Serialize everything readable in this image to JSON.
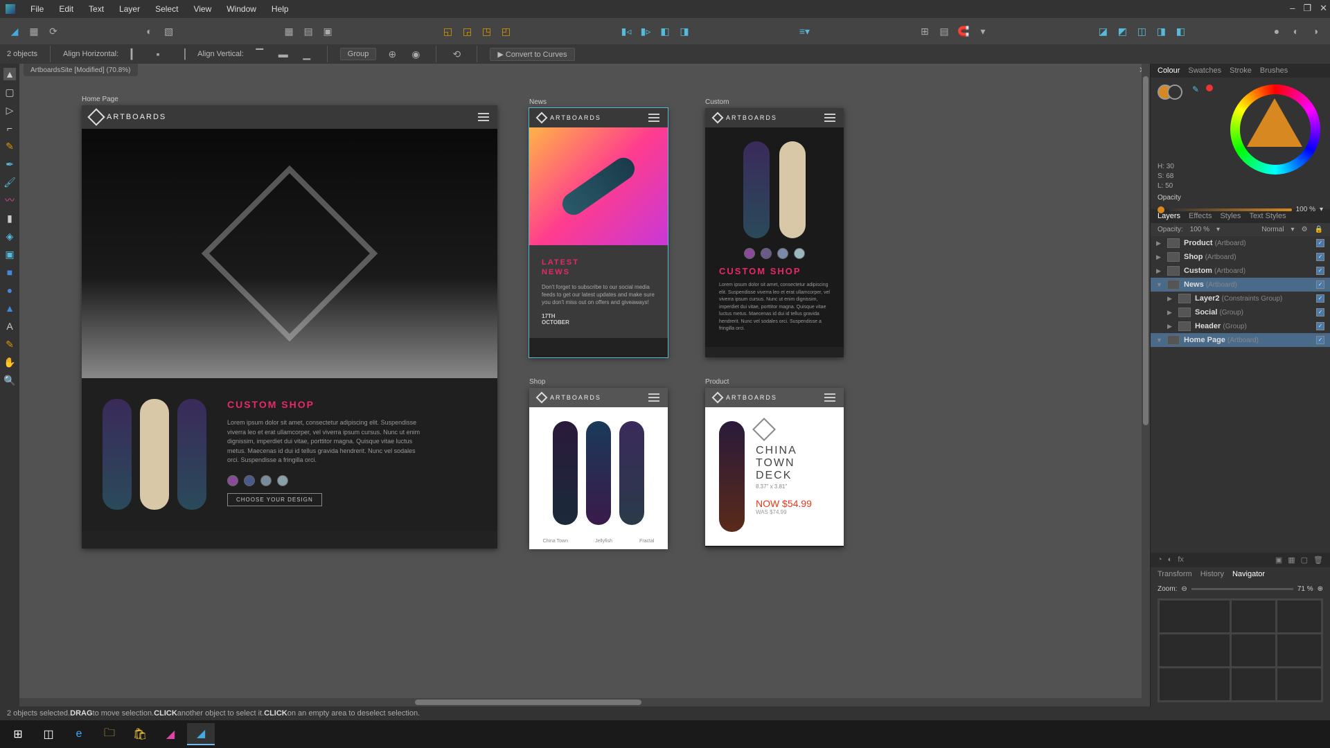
{
  "menu": {
    "items": [
      "File",
      "Edit",
      "Text",
      "Layer",
      "Select",
      "View",
      "Window",
      "Help"
    ]
  },
  "window_controls": [
    "–",
    "❐",
    "✕"
  ],
  "contextbar": {
    "selection": "2 objects",
    "align_h": "Align Horizontal:",
    "align_v": "Align Vertical:",
    "group": "Group",
    "convert": "Convert to Curves"
  },
  "document": {
    "tab": "ArtboardsSite [Modified] (70.8%)"
  },
  "artboards": {
    "home": {
      "label": "Home Page",
      "brand": "ARTBOARDS"
    },
    "news": {
      "label": "News",
      "brand": "ARTBOARDS",
      "title": "LATEST\nNEWS",
      "body": "Don't forget to subscribe to our social media feeds to get our latest updates and make sure you don't miss out on offers and giveaways!",
      "date": "17TH\nOCTOBER"
    },
    "custom": {
      "label": "Custom",
      "brand": "ARTBOARDS",
      "title": "CUSTOM SHOP",
      "body": "Lorem ipsum dolor sit amet, consectetur adipiscing elit. Suspendisse viverra leo et erat ullamcorper, vel viverra ipsum cursus. Nunc ut enim dignissim, imperdiet dui vitae, porttitor magna. Quisque vitae luctus metus. Maecenas id dui id tellus gravida hendrerit. Nunc vel sodales orci. Suspendisse a fringilla orci."
    },
    "shop": {
      "label": "Shop",
      "brand": "ARTBOARDS",
      "p1": "China Town",
      "p2": "Jellyfish",
      "p3": "Fractal"
    },
    "product": {
      "label": "Product",
      "brand": "ARTBOARDS",
      "name": "CHINA TOWN\nDECK",
      "dim": "8.37\" x 3.81\"",
      "price": "NOW $54.99",
      "was": "WAS $74.99"
    }
  },
  "home_custom": {
    "title": "CUSTOM SHOP",
    "body": "Lorem ipsum dolor sit amet, consectetur adipiscing elit. Suspendisse viverra leo et erat ullamcorper, vel viverra ipsum cursus. Nunc ut enim dignissim, imperdiet dui vitae, porttitor magna. Quisque vitae luctus metus. Maecenas id dui id tellus gravida hendrerit. Nunc vel sodales orci. Suspendisse a fringilla orci.",
    "btn": "CHOOSE YOUR DESIGN"
  },
  "colour": {
    "tabs": [
      "Colour",
      "Swatches",
      "Stroke",
      "Brushes"
    ],
    "hsl": {
      "h": "H: 30",
      "s": "S: 68",
      "l": "L: 50"
    },
    "opacity_label": "Opacity",
    "opacity_val": "100 %"
  },
  "layers": {
    "tabs": [
      "Layers",
      "Effects",
      "Styles",
      "Text Styles"
    ],
    "opacity_label": "Opacity:",
    "opacity_val": "100 %",
    "blend": "Normal",
    "items": [
      {
        "name": "Product",
        "type": "(Artboard)",
        "sel": false,
        "indent": 0,
        "exp": "▶"
      },
      {
        "name": "Shop",
        "type": "(Artboard)",
        "sel": false,
        "indent": 0,
        "exp": "▶"
      },
      {
        "name": "Custom",
        "type": "(Artboard)",
        "sel": false,
        "indent": 0,
        "exp": "▶"
      },
      {
        "name": "News",
        "type": "(Artboard)",
        "sel": true,
        "indent": 0,
        "exp": "▼"
      },
      {
        "name": "Layer2",
        "type": "(Constraints Group)",
        "sel": false,
        "indent": 1,
        "exp": "▶"
      },
      {
        "name": "Social",
        "type": "(Group)",
        "sel": false,
        "indent": 1,
        "exp": "▶"
      },
      {
        "name": "Header",
        "type": "(Group)",
        "sel": false,
        "indent": 1,
        "exp": "▶"
      },
      {
        "name": "Home Page",
        "type": "(Artboard)",
        "sel": true,
        "indent": 0,
        "exp": "▼"
      }
    ]
  },
  "navigator": {
    "tabs": [
      "Transform",
      "History",
      "Navigator"
    ],
    "zoom_label": "Zoom:",
    "zoom_val": "71 %"
  },
  "statusbar": {
    "t1": "2 objects selected. ",
    "b1": "DRAG",
    "t2": " to move selection. ",
    "b2": "CLICK",
    "t3": " another object to select it. ",
    "b3": "CLICK",
    "t4": " on an empty area to deselect selection."
  }
}
